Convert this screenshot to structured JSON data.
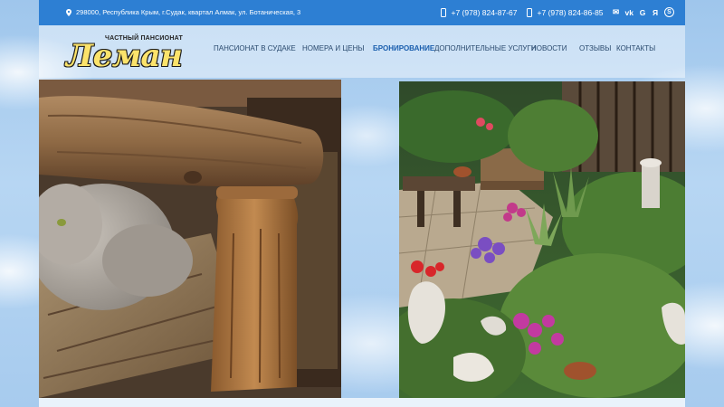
{
  "topbar": {
    "address": "298000, Республика Крым, г.Судак, квартал Алмак, ул. Ботаническая, 3",
    "phone1": "+7 (978) 824-87-67",
    "phone2": "+7 (978) 824-86-85",
    "social": [
      {
        "icon": "mail-icon",
        "glyph": "✉"
      },
      {
        "icon": "vk-icon",
        "glyph": "vk"
      },
      {
        "icon": "google-icon",
        "glyph": "G"
      },
      {
        "icon": "yandex-icon",
        "glyph": "Я"
      },
      {
        "icon": "skype-icon",
        "glyph": "S"
      }
    ]
  },
  "logo": {
    "small_text": "ЧАСТНЫЙ ПАНСИОНАТ",
    "big_text": "Леман"
  },
  "nav": {
    "items": [
      {
        "label": "ПАНСИОНАТ В СУДАКЕ",
        "active": false
      },
      {
        "label": "НОМЕРА И ЦЕНЫ",
        "active": false
      },
      {
        "label": "БРОНИРОВАНИЕ",
        "active": true
      },
      {
        "label": "ДОПОЛНИТЕЛЬНЫЕ УСЛУГИ",
        "active": false
      },
      {
        "label": "НОВОСТИ",
        "active": false
      },
      {
        "label": "ОТЗЫВЫ",
        "active": false
      },
      {
        "label": "КОНТАКТЫ",
        "active": false
      }
    ]
  },
  "colors": {
    "topbar": "#2d7fd3",
    "nav_text": "#2a4a6e",
    "nav_active": "#1b5fae",
    "logo_fill": "#fbe36b"
  }
}
